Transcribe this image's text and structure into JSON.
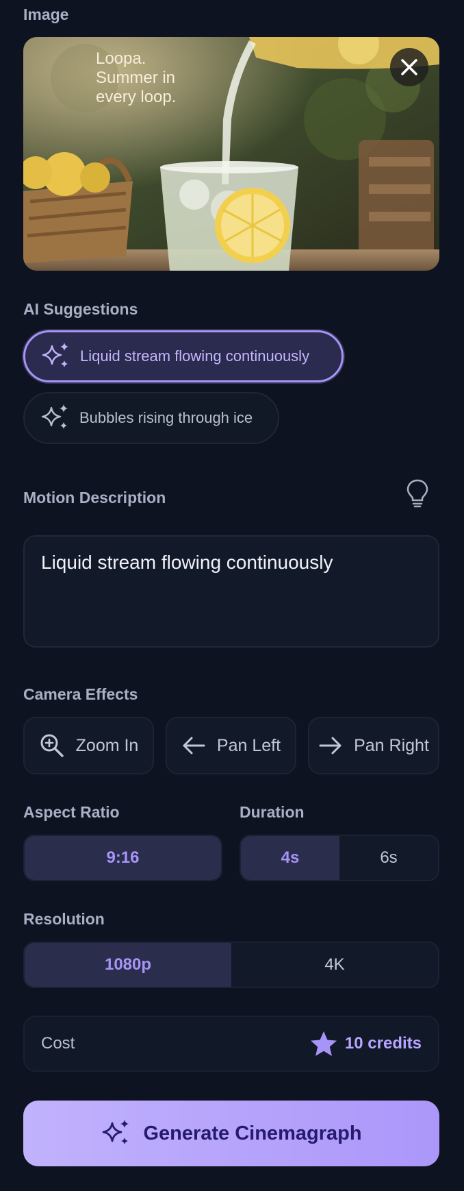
{
  "image": {
    "section_label": "Image",
    "caption_lines": [
      "Loopa.",
      "Summer in",
      "every loop."
    ]
  },
  "suggestions": {
    "section_label": "AI Suggestions",
    "items": [
      {
        "label": "Liquid stream flowing continuously",
        "selected": true
      },
      {
        "label": "Bubbles rising through ice",
        "selected": false
      }
    ]
  },
  "motion": {
    "section_label": "Motion Description",
    "value": "Liquid stream flowing continuously"
  },
  "camera": {
    "section_label": "Camera Effects",
    "effects": [
      {
        "label": "Zoom In",
        "icon": "zoom-in-icon"
      },
      {
        "label": "Pan Left",
        "icon": "arrow-left-icon"
      },
      {
        "label": "Pan Right",
        "icon": "arrow-right-icon"
      }
    ]
  },
  "aspect_ratio": {
    "section_label": "Aspect Ratio",
    "options": [
      "9:16"
    ],
    "selected": "9:16"
  },
  "duration": {
    "section_label": "Duration",
    "options": [
      "4s",
      "6s"
    ],
    "selected": "4s"
  },
  "resolution": {
    "section_label": "Resolution",
    "options": [
      "1080p",
      "4K"
    ],
    "selected": "1080p"
  },
  "cost": {
    "label": "Cost",
    "value": "10 credits"
  },
  "generate": {
    "label": "Generate Cinemagraph"
  },
  "colors": {
    "background": "#0d1320",
    "accent": "#a794f7",
    "button": "#b7a5fb"
  }
}
